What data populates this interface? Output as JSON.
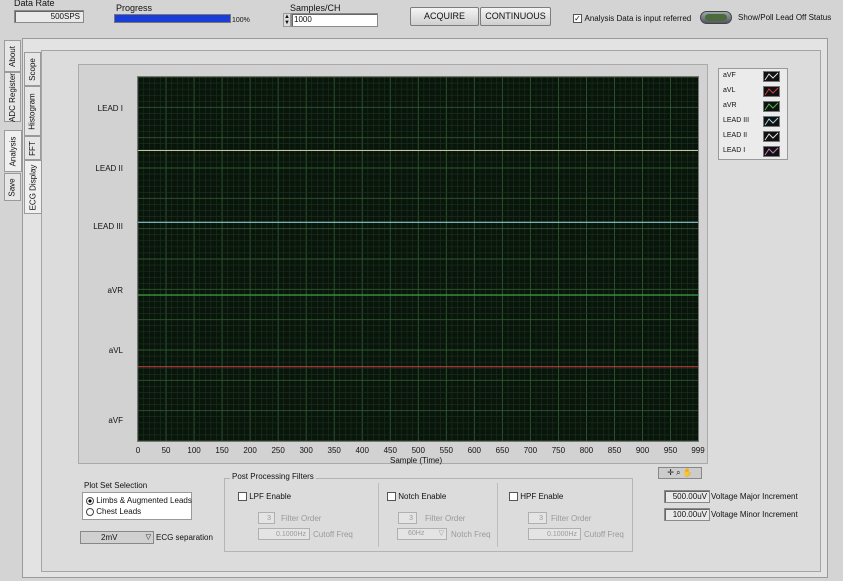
{
  "top": {
    "data_rate_label": "Data Rate",
    "data_rate_value": "500SPS",
    "progress_label": "Progress",
    "progress_percent": 100,
    "progress_text": "100%",
    "samples_label": "Samples/CH",
    "samples_value": "1000",
    "acquire_label": "ACQUIRE",
    "continuous_label": "CONTINUOUS",
    "input_referred_label": "Analysis Data is input referred",
    "input_referred_checked": true,
    "lead_off_label": "Show/Poll Lead Off Status"
  },
  "outer_tabs": [
    "About",
    "ADC Register",
    "Analysis",
    "Save"
  ],
  "inner_tabs": [
    "Scope",
    "Histogram",
    "FFT",
    "ECG Display"
  ],
  "plot": {
    "x_axis_label": "Sample (Time)",
    "x_ticks": [
      "0",
      "50",
      "100",
      "150",
      "200",
      "250",
      "300",
      "350",
      "400",
      "450",
      "500",
      "550",
      "600",
      "650",
      "700",
      "750",
      "800",
      "850",
      "900",
      "950",
      "999"
    ],
    "y_labels": [
      "LEAD I",
      "LEAD II",
      "LEAD III",
      "aVR",
      "aVL",
      "aVF"
    ],
    "trace_colors": {
      "LEAD II": "#c8c8a0",
      "LEAD III": "#9ed8e8",
      "aVR": "#48c048",
      "aVL": "#d04040"
    }
  },
  "legend": [
    {
      "name": "aVF",
      "color": "#e0e0e0"
    },
    {
      "name": "aVL",
      "color": "#d04040"
    },
    {
      "name": "aVR",
      "color": "#48c048"
    },
    {
      "name": "LEAD III",
      "color": "#9ed8e8"
    },
    {
      "name": "LEAD II",
      "color": "#e0e0e0"
    },
    {
      "name": "LEAD I",
      "color": "#c080c0"
    }
  ],
  "plot_set": {
    "title": "Plot Set Selection",
    "options": [
      "Limbs & Augmented Leads",
      "Chest Leads"
    ],
    "selected": "Limbs & Augmented Leads"
  },
  "ecg_sep": {
    "value": "2mV",
    "label": "ECG separation"
  },
  "filters": {
    "title": "Post Processing Filters",
    "lpf": {
      "label": "LPF Enable",
      "order": "3",
      "order_label": "Filter Order",
      "cutoff": "0.1000Hz",
      "cutoff_label": "Cutoff Freq"
    },
    "notch": {
      "label": "Notch Enable",
      "order": "3",
      "order_label": "Filter Order",
      "freq": "60Hz",
      "freq_label": "Notch Freq"
    },
    "hpf": {
      "label": "HPF Enable",
      "order": "3",
      "order_label": "Filter Order",
      "cutoff": "0.1000Hz",
      "cutoff_label": "Cutoff Freq"
    }
  },
  "voltage": {
    "major_value": "500.00uV",
    "major_label": "Voltage Major Increment",
    "minor_value": "100.00uV",
    "minor_label": "Voltage Minor Increment"
  }
}
